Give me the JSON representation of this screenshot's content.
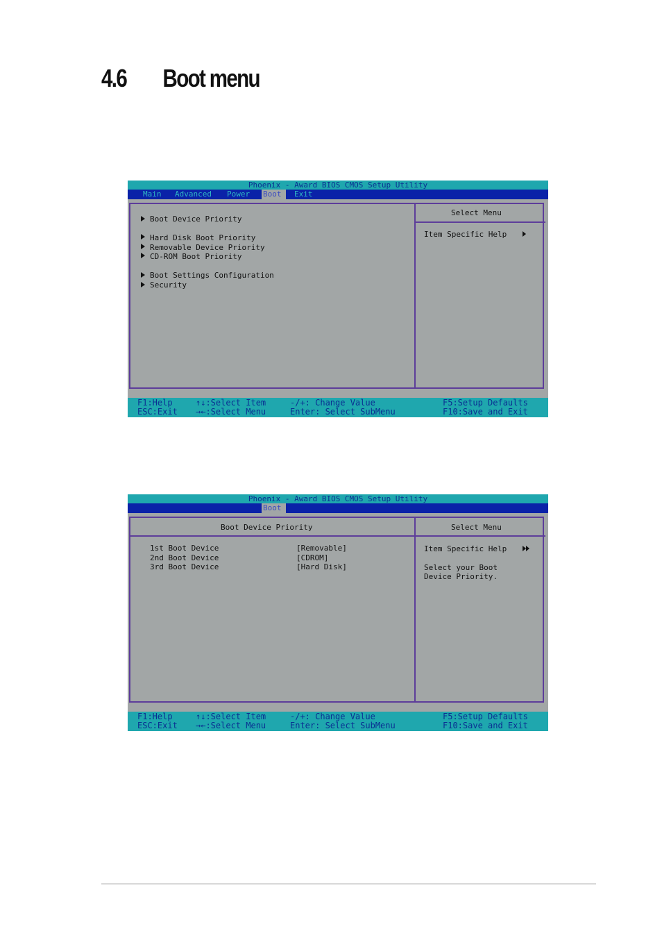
{
  "section": {
    "number": "4.6",
    "title": "Boot menu"
  },
  "screen1": {
    "title_bar": "Phoenix - Award BIOS CMOS Setup Utility",
    "menu": [
      "Main",
      "Advanced",
      "Power",
      "Boot",
      "Exit"
    ],
    "active_menu": "Boot",
    "items": [
      "Boot Device Priority",
      "Hard Disk Boot Priority",
      "Removable Device Priority",
      "CD-ROM Boot Priority",
      "Boot Settings Configuration",
      "Security"
    ],
    "side_header": "Select Menu",
    "help_title": "Item Specific Help",
    "footer": {
      "f1": "F1:Help",
      "esc": "ESC:Exit",
      "select_item": "↑↓:Select Item",
      "select_menu": "→←:Select Menu",
      "change_value": "-/+: Change Value",
      "enter": "Enter: Select SubMenu",
      "f5": "F5:Setup Defaults",
      "f10": "F10:Save and Exit"
    }
  },
  "screen2": {
    "title_bar": "Phoenix - Award BIOS CMOS Setup Utility",
    "active_menu": "Boot",
    "panel_title": "Boot Device Priority",
    "rows": [
      {
        "label": "1st Boot Device",
        "value": "[Removable]"
      },
      {
        "label": "2nd Boot Device",
        "value": "[CDROM]"
      },
      {
        "label": "3rd Boot Device",
        "value": "[Hard Disk]"
      }
    ],
    "side_header": "Select Menu",
    "help_title": "Item Specific Help",
    "help_lines": [
      "Select your Boot",
      "Device Priority."
    ],
    "footer": {
      "f1": "F1:Help",
      "esc": "ESC:Exit",
      "select_item": "↑↓:Select Item",
      "select_menu": "→←:Select Menu",
      "change_value": "-/+: Change Value",
      "enter": "Enter: Select SubMenu",
      "f5": "F5:Setup Defaults",
      "f10": "F10:Save and Exit"
    }
  },
  "colors": {
    "title_bar": "#1fa7ae",
    "menu_bar": "#0a22a8",
    "panel": "#a2a6a6",
    "border": "#5d3d9a"
  }
}
